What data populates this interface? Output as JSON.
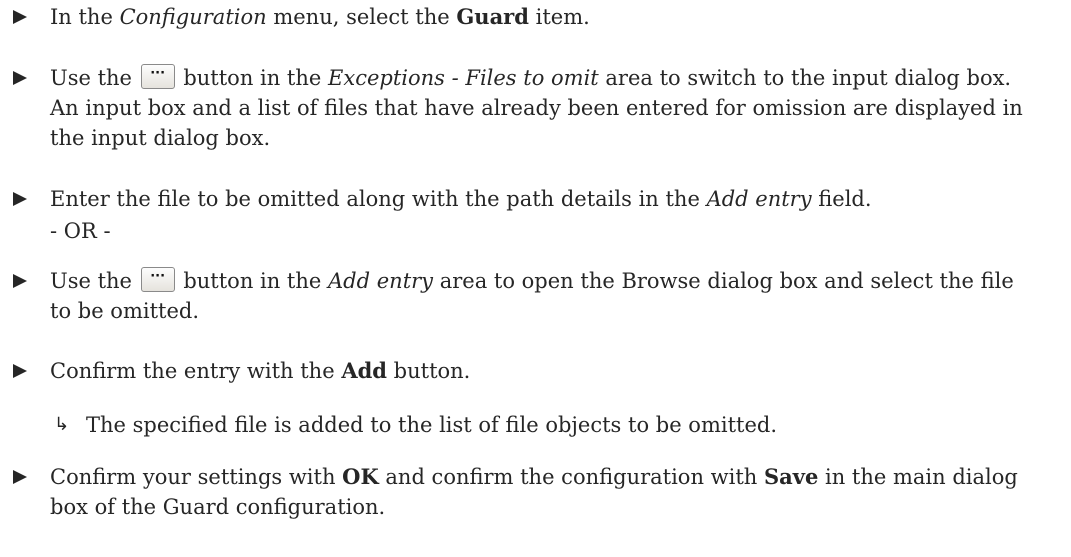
{
  "steps": [
    {
      "p1": "In the ",
      "p2": "Configuration",
      "p3": " menu, select the ",
      "p4": "Guard",
      "p5": " item."
    },
    {
      "p1": "Use the ",
      "p2": " button in the ",
      "p3": "Exceptions - Files to omit",
      "p4": " area to switch to the input dialog box. An input box and a list of files that have already been entered for omission are displayed in the input dialog box."
    },
    {
      "p1": "Enter the file to be omitted along with the path details in the ",
      "p2": "Add entry",
      "p3": " field."
    },
    {
      "p1": "Use the ",
      "p2": " button in the ",
      "p3": "Add entry",
      "p4": " area to open the Browse dialog box and select the file to be omitted."
    },
    {
      "p1": "Confirm the entry with the ",
      "p2": "Add",
      "p3": " button."
    },
    {
      "p1": "Confirm your settings with ",
      "p2": "OK",
      "p3": " and confirm the configuration with ",
      "p4": "Save",
      "p5": " in the main dialog box of the Guard configuration."
    }
  ],
  "or_separator": "- OR -",
  "result": {
    "arrow": "↳",
    "text": "The specified file is added to the list of file objects to be omitted."
  },
  "button_glyph": "···",
  "icons": {
    "bullet": "triangle-right-icon",
    "result": "result-arrow-icon",
    "button": "ellipsis-button"
  },
  "colors": {
    "text": "#262626",
    "button_border": "#8a8a8a"
  }
}
